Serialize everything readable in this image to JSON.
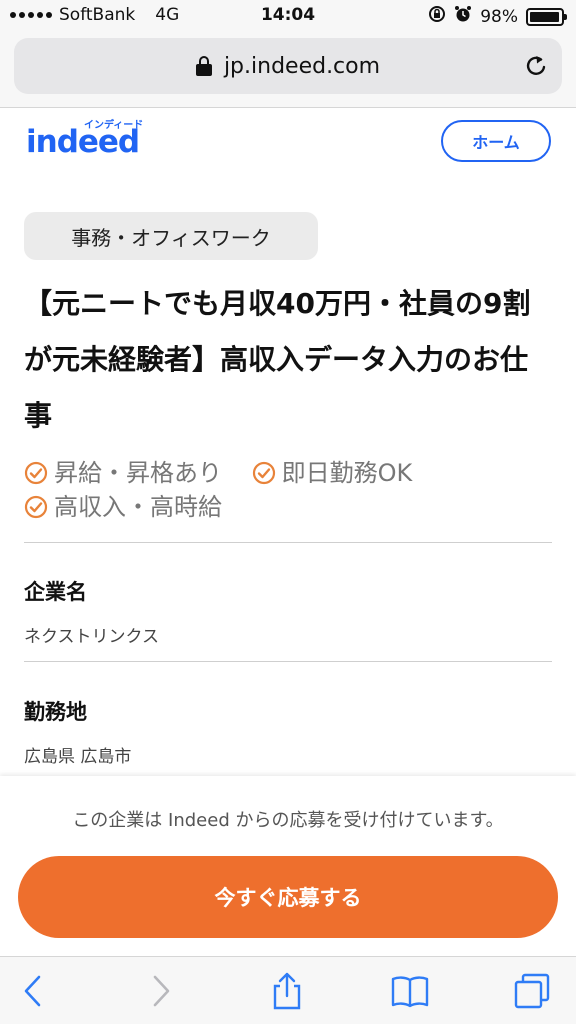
{
  "status_bar": {
    "carrier": "SoftBank",
    "network": "4G",
    "time": "14:04",
    "battery": "98%",
    "battery_level": 0.98
  },
  "browser": {
    "url": "jp.indeed.com"
  },
  "header": {
    "logo_text": "indeed",
    "logo_kana": "インディード",
    "home_label": "ホーム"
  },
  "job": {
    "category": "事務・オフィスワーク",
    "title": "【元ニートでも月収40万円・社員の9割が元未経験者】高収入データ入力のお仕事",
    "tags": [
      "昇給・昇格あり",
      "即日勤務OK",
      "高収入・高時給"
    ]
  },
  "sections": {
    "company_label": "企業名",
    "company_value": "ネクストリンクス",
    "location_label": "勤務地",
    "location_value": "広島県 広島市"
  },
  "apply": {
    "note": "この企業は Indeed からの応募を受け付けています。",
    "button_label": "今すぐ応募する"
  },
  "colors": {
    "brand_blue": "#2164f3",
    "apply_orange": "#ee6f2d",
    "check_orange": "#e8833a"
  }
}
